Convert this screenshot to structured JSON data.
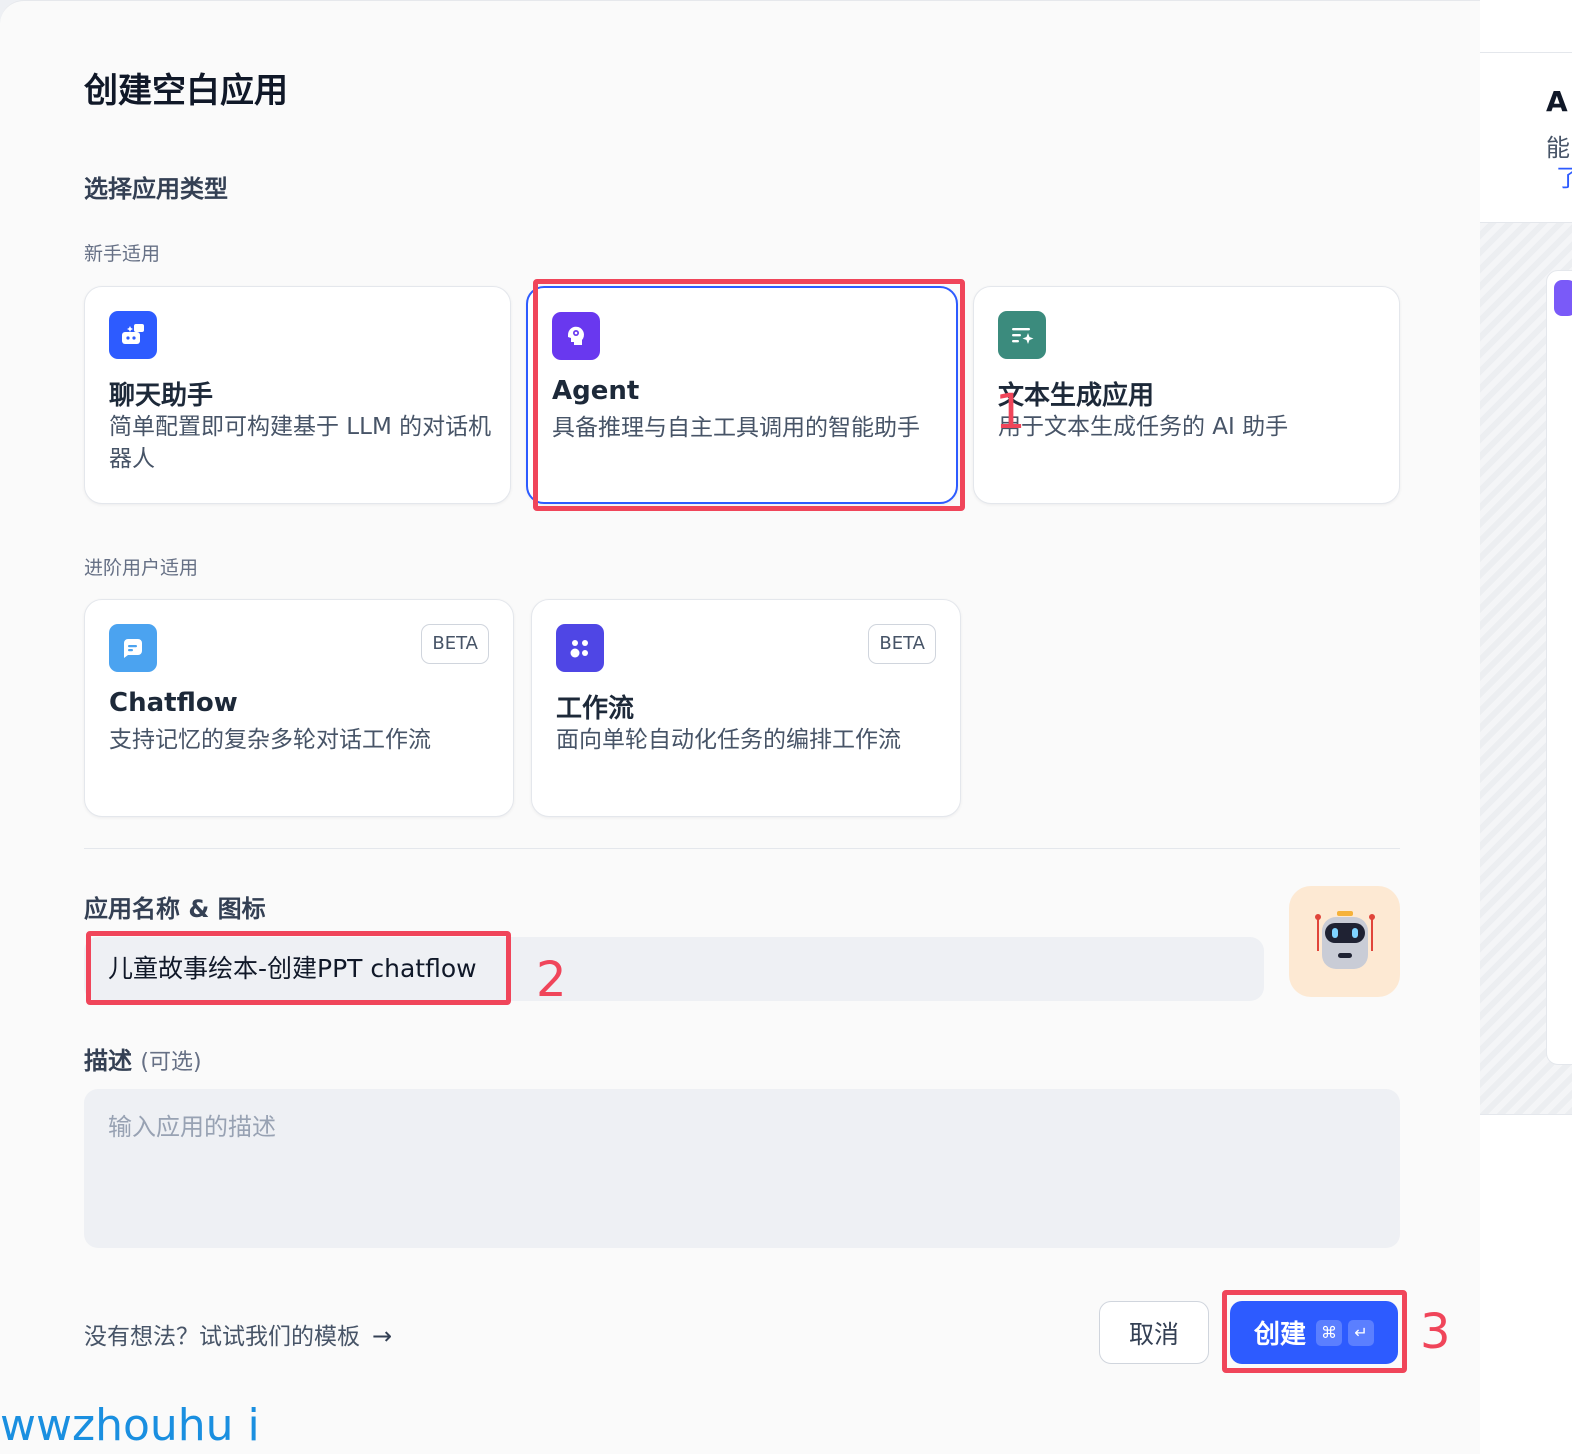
{
  "dialog": {
    "title": "创建空白应用",
    "section_title": "选择应用类型",
    "beginner_label": "新手适用",
    "advanced_label": "进阶用户适用"
  },
  "app_types": {
    "chat": {
      "name": "聊天助手",
      "desc": "简单配置即可构建基于 LLM 的对话机器人",
      "icon": "chat-bot-icon",
      "color": "#2d5bff"
    },
    "agent": {
      "name": "Agent",
      "desc": "具备推理与自主工具调用的智能助手",
      "icon": "agent-brain-icon",
      "color": "#6938ef",
      "selected": true
    },
    "text": {
      "name": "文本生成应用",
      "desc": "用于文本生成任务的 AI 助手",
      "icon": "text-generation-icon",
      "color": "#3b8b7d"
    },
    "chatflow": {
      "name": "Chatflow",
      "desc": "支持记忆的复杂多轮对话工作流",
      "badge": "BETA",
      "icon": "chatflow-icon",
      "color": "#4ba3f0"
    },
    "workflow": {
      "name": "工作流",
      "desc": "面向单轮自动化任务的编排工作流",
      "badge": "BETA",
      "icon": "workflow-icon",
      "color": "#4f46e5"
    }
  },
  "name_field": {
    "label": "应用名称 & 图标",
    "value": "儿童故事绘本-创建PPT chatflow",
    "app_icon": "robot-icon"
  },
  "desc_field": {
    "label": "描述",
    "optional": "(可选)",
    "placeholder": "输入应用的描述"
  },
  "footer": {
    "template_link": "没有想法？试试我们的模板",
    "cancel": "取消",
    "create": "创建",
    "shortcut_cmd": "⌘",
    "shortcut_enter": "↵"
  },
  "annotations": {
    "one": "1",
    "two": "2",
    "three": "3"
  },
  "watermark": "wwzhouhu i",
  "background_panel": {
    "head": "A",
    "line1": "能",
    "line2": "了"
  },
  "colors": {
    "primary": "#2d5bff",
    "annotation": "#f0455a"
  }
}
